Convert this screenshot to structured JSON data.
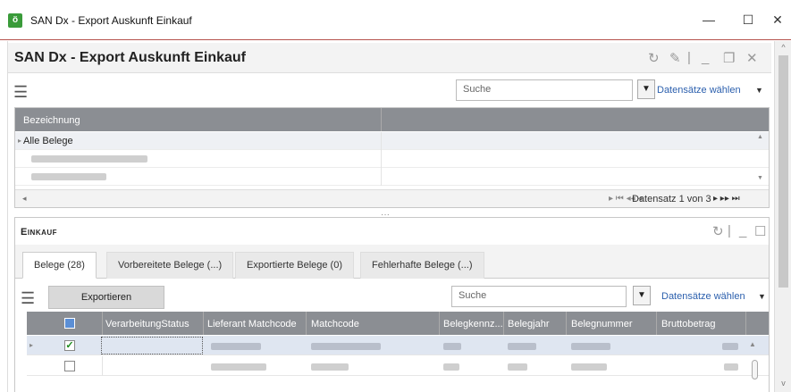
{
  "window": {
    "app_icon_glyph": "ö",
    "title": "SAN Dx - Export Auskunft Einkauf",
    "controls": {
      "minimize": "—",
      "maximize": "☐",
      "close": "✕"
    }
  },
  "panel": {
    "title": "SAN Dx - Export Auskunft Einkauf",
    "icons": [
      "refresh-icon",
      "wrench-icon",
      "minimize-icon",
      "restore-icon",
      "close-icon"
    ]
  },
  "top_toolbar": {
    "search_placeholder": "Suche",
    "filter_glyph": "▼",
    "datasets_label": "Datensätze wählen",
    "datasets_caret": "▼"
  },
  "top_grid": {
    "header": "Bezeichnung",
    "first_row": "Alle Belege",
    "pager_text": "Datensatz 1 von 3"
  },
  "einkauf": {
    "title": "Einkauf",
    "tabs": [
      "Belege (28)",
      "Vorbereitete Belege (...)",
      "Exportierte Belege (0)",
      "Fehlerhafte Belege (...)"
    ],
    "export_button": "Exportieren",
    "search_placeholder": "Suche",
    "filter_glyph": "▼",
    "datasets_label": "Datensätze wählen",
    "datasets_caret": "▼",
    "columns": [
      "VerarbeitungStatus",
      "Lieferant Matchcode",
      "Matchcode",
      "Belegkennz...",
      "Belegjahr",
      "Belegnummer",
      "Bruttobetrag"
    ]
  }
}
